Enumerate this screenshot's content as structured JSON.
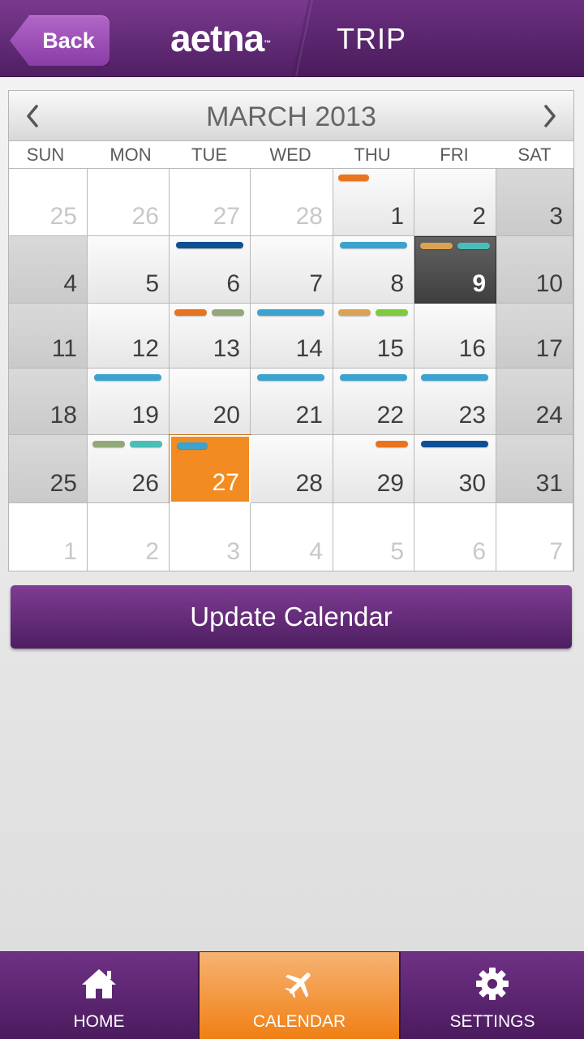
{
  "header": {
    "back_label": "Back",
    "logo_text": "aetna",
    "logo_tm": "™",
    "title": "TRIP"
  },
  "calendar": {
    "month_label": "MARCH 2013",
    "weekdays": [
      "SUN",
      "MON",
      "TUE",
      "WED",
      "THU",
      "FRI",
      "SAT"
    ],
    "weeks": [
      [
        {
          "num": "25",
          "type": "out"
        },
        {
          "num": "26",
          "type": "out"
        },
        {
          "num": "27",
          "type": "out"
        },
        {
          "num": "28",
          "type": "out"
        },
        {
          "num": "1",
          "type": "normal",
          "events": [
            "orange-short"
          ]
        },
        {
          "num": "2",
          "type": "normal"
        },
        {
          "num": "3",
          "type": "weekend"
        }
      ],
      [
        {
          "num": "4",
          "type": "weekend"
        },
        {
          "num": "5",
          "type": "normal"
        },
        {
          "num": "6",
          "type": "normal",
          "events": [
            "navy"
          ]
        },
        {
          "num": "7",
          "type": "normal"
        },
        {
          "num": "8",
          "type": "normal",
          "events": [
            "blue"
          ]
        },
        {
          "num": "9",
          "type": "today",
          "events": [
            "gold",
            "teal"
          ]
        },
        {
          "num": "10",
          "type": "weekend"
        }
      ],
      [
        {
          "num": "11",
          "type": "weekend"
        },
        {
          "num": "12",
          "type": "normal"
        },
        {
          "num": "13",
          "type": "normal",
          "events": [
            "orange",
            "olive"
          ]
        },
        {
          "num": "14",
          "type": "normal",
          "events": [
            "blue"
          ]
        },
        {
          "num": "15",
          "type": "normal",
          "events": [
            "gold",
            "green"
          ]
        },
        {
          "num": "16",
          "type": "normal"
        },
        {
          "num": "17",
          "type": "weekend"
        }
      ],
      [
        {
          "num": "18",
          "type": "weekend"
        },
        {
          "num": "19",
          "type": "normal",
          "events": [
            "blue"
          ]
        },
        {
          "num": "20",
          "type": "normal"
        },
        {
          "num": "21",
          "type": "normal",
          "events": [
            "blue"
          ]
        },
        {
          "num": "22",
          "type": "normal",
          "events": [
            "blue"
          ]
        },
        {
          "num": "23",
          "type": "normal",
          "events": [
            "blue"
          ]
        },
        {
          "num": "24",
          "type": "weekend"
        }
      ],
      [
        {
          "num": "25",
          "type": "weekend"
        },
        {
          "num": "26",
          "type": "normal",
          "events": [
            "olive",
            "teal"
          ]
        },
        {
          "num": "27",
          "type": "selected",
          "events": [
            "blue-short"
          ]
        },
        {
          "num": "28",
          "type": "normal"
        },
        {
          "num": "29",
          "type": "normal",
          "events": [
            "orange-right"
          ]
        },
        {
          "num": "30",
          "type": "normal",
          "events": [
            "navy"
          ]
        },
        {
          "num": "31",
          "type": "weekend"
        }
      ],
      [
        {
          "num": "1",
          "type": "out"
        },
        {
          "num": "2",
          "type": "out"
        },
        {
          "num": "3",
          "type": "out"
        },
        {
          "num": "4",
          "type": "out"
        },
        {
          "num": "5",
          "type": "out"
        },
        {
          "num": "6",
          "type": "out"
        },
        {
          "num": "7",
          "type": "out"
        }
      ]
    ],
    "event_colors": {
      "orange": "#e8741e",
      "olive": "#93a878",
      "navy": "#0f4f94",
      "blue": "#3aa3cf",
      "teal": "#4bbcb8",
      "gold": "#dba253",
      "green": "#7fcb3f"
    }
  },
  "update_button": {
    "label": "Update Calendar"
  },
  "tabs": [
    {
      "label": "HOME",
      "icon": "home-icon"
    },
    {
      "label": "CALENDAR",
      "icon": "airplane-icon",
      "active": true
    },
    {
      "label": "SETTINGS",
      "icon": "gear-icon"
    }
  ],
  "colors": {
    "brand_purple": "#5e2673",
    "accent_orange": "#f28c22"
  }
}
